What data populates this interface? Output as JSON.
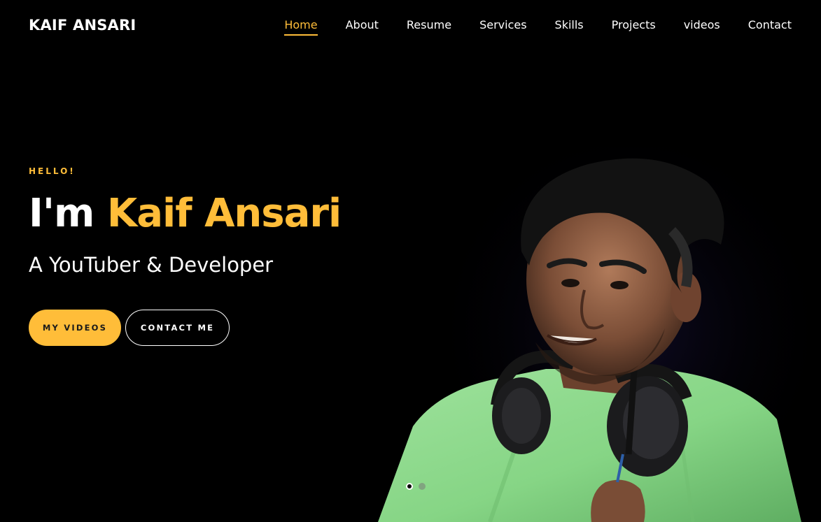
{
  "header": {
    "logo": "KAIF ANSARI",
    "nav": [
      {
        "label": "Home",
        "active": true
      },
      {
        "label": "About",
        "active": false
      },
      {
        "label": "Resume",
        "active": false
      },
      {
        "label": "Services",
        "active": false
      },
      {
        "label": "Skills",
        "active": false
      },
      {
        "label": "Projects",
        "active": false
      },
      {
        "label": "videos",
        "active": false
      },
      {
        "label": "Contact",
        "active": false
      }
    ]
  },
  "hero": {
    "greeting": "HELLO!",
    "headline_prefix": "I'm",
    "headline_name": "Kaif Ansari",
    "subtitle": "A YouTuber & Developer",
    "primary_button": "MY VIDEOS",
    "secondary_button": "CONTACT ME"
  },
  "carousel": {
    "slide_count": 2,
    "active_index": 0
  },
  "colors": {
    "accent": "#ffbd39",
    "background": "#000000",
    "shirt": "#8fdc8f"
  },
  "icons": {
    "portrait": "person-with-headphones"
  }
}
